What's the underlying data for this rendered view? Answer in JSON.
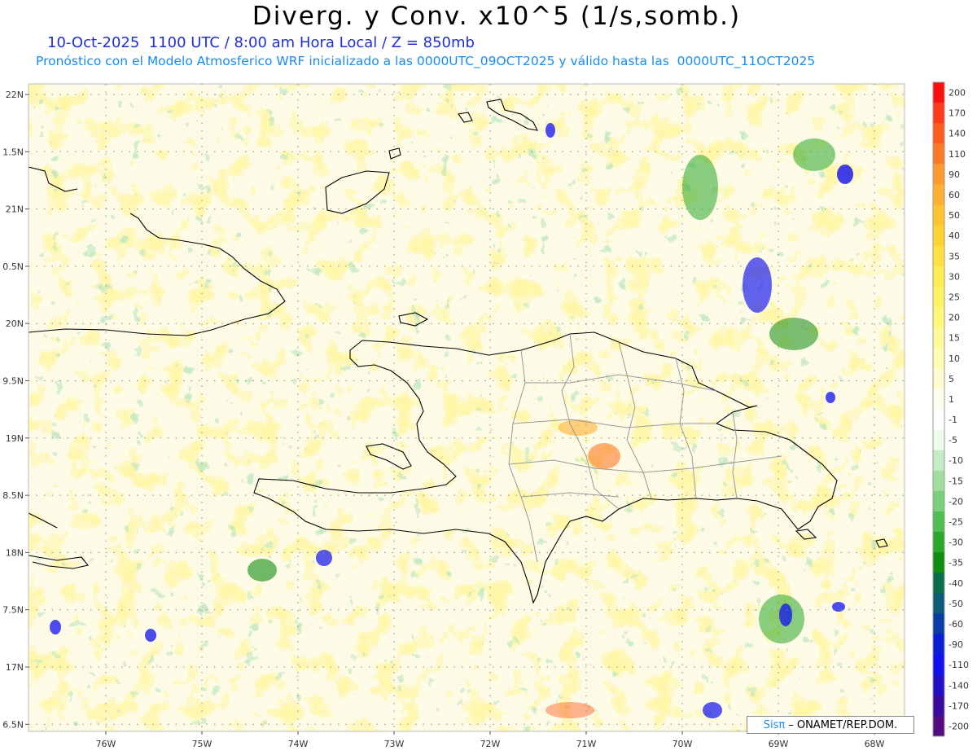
{
  "header": {
    "title": "Diverg. y Conv. x10^5 (1/s,somb.)",
    "subtitle_1": "10-Oct-2025  1100 UTC / 8:00 am Hora Local / Z = 850mb",
    "subtitle_2": "Pronóstico con el Modelo Atmosferico WRF inicializado a las 0000UTC_09OCT2025 y válido hasta las  0000UTC_11OCT2025"
  },
  "map": {
    "lat_labels": [
      "22N",
      "1.5N",
      "21N",
      "0.5N",
      "20N",
      "9.5N",
      "19N",
      "8.5N",
      "18N",
      "7.5N",
      "17N",
      "6.5N"
    ],
    "lon_labels": [
      "76W",
      "75W",
      "74W",
      "73W",
      "72W",
      "71W",
      "70W",
      "69W",
      "68W"
    ]
  },
  "colorbar": {
    "labels": [
      "200",
      "170",
      "140",
      "110",
      "90",
      "60",
      "50",
      "40",
      "35",
      "30",
      "25",
      "20",
      "15",
      "10",
      "5",
      "1",
      "-1",
      "-5",
      "-10",
      "-15",
      "-20",
      "-25",
      "-30",
      "-35",
      "-40",
      "-50",
      "-60",
      "-90",
      "-110",
      "-140",
      "-170",
      "-200"
    ],
    "colors": [
      "#ff1010",
      "#ff3a1a",
      "#ff5a20",
      "#ff7a28",
      "#ff9a30",
      "#ffb030",
      "#ffc430",
      "#ffd430",
      "#ffe040",
      "#ffec50",
      "#fff460",
      "#fff878",
      "#fffa98",
      "#fffcb4",
      "#fffdd0",
      "#ffffee",
      "#ffffff",
      "#f0fbf0",
      "#c4ecc4",
      "#a0dea0",
      "#7ad07a",
      "#50be50",
      "#2aa82a",
      "#108c10",
      "#0a6e48",
      "#0a5a78",
      "#0a3ca8",
      "#0a1ed8",
      "#1010f0",
      "#2010c8",
      "#3a0aa0",
      "#540a80"
    ]
  },
  "credit": {
    "brand": "Sisπ",
    "text": "– ONAMET/REP.DOM."
  }
}
